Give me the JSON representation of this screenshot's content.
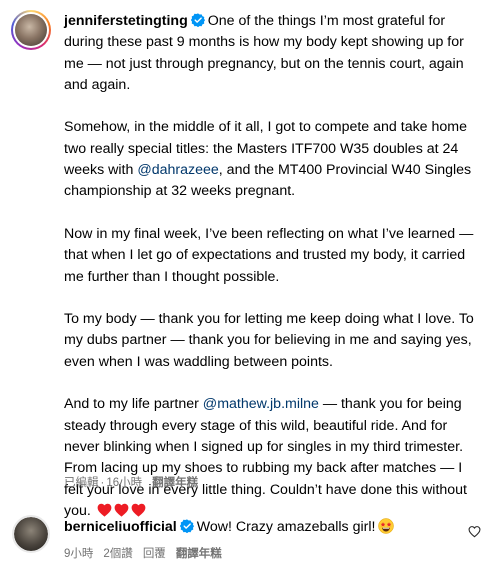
{
  "post": {
    "username": "jenniferstetingting",
    "paragraphs": [
      {
        "before": "One of the things I’m most grateful for during these past 9 months is how my body kept showing up for me — not just through pregnancy, but on the tennis court, again and again."
      },
      {
        "before": "Somehow, in the middle of it all, I got to compete and take home two really special titles: the Masters ITF700 W35 doubles at 24 weeks with ",
        "mention": "@dahrazeee",
        "after": ", and the MT400 Provincial W40 Singles championship at 32 weeks pregnant."
      },
      {
        "before": "Now in my final week, I’ve been reflecting on what I’ve learned — that when I let go of expectations and trusted my body, it carried me further than I thought possible."
      },
      {
        "before": "To my body — thank you for letting me keep doing what I love. To my dubs partner — thank you for believing in me and saying yes, even when I was waddling between points."
      },
      {
        "before": "And to my life partner ",
        "mention": "@mathew.jb.milne",
        "after": " — thank you for being steady through every stage of this wild, beautiful ride. And for never blinking when I signed up for singles in my third trimester. From lacing up my shoes to rubbing my back after matches — I felt your love in every little thing. Couldn’t have done this without you."
      }
    ],
    "end_emoji": [
      "red-heart",
      "red-heart",
      "red-heart"
    ],
    "meta": {
      "edited": "已編輯",
      "separator": "·",
      "time": "16小時",
      "translate": "翻譯年糕"
    }
  },
  "comment": {
    "username": "berniceliuofficial",
    "text": "Wow! Crazy amazeballs girl!",
    "emoji": "star-struck-face",
    "meta": {
      "time": "9小時",
      "likes": "2個讚",
      "reply": "回覆",
      "translate": "翻譯年糕"
    }
  },
  "colors": {
    "text": "#000000",
    "mention": "#00376b",
    "meta": "#737373",
    "verified": "#0095f6",
    "heart": "#ed1c24"
  },
  "icons": [
    "verified-badge-icon",
    "red-heart-icon",
    "star-struck-emoji-icon",
    "like-heart-icon"
  ]
}
